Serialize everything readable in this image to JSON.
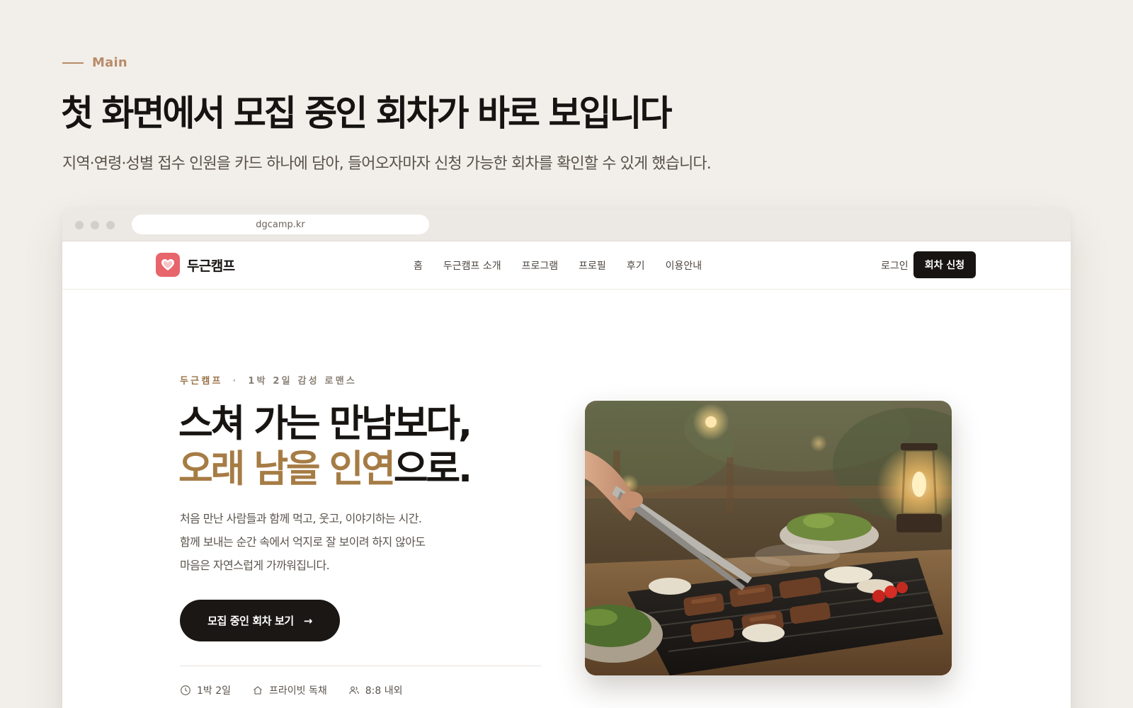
{
  "section": {
    "eyebrow": "Main",
    "title": "첫 화면에서 모집 중인 회차가 바로 보입니다",
    "description": "지역·연령·성별 접수 인원을 카드 하나에 담아, 들어오자마자 신청 가능한 회차를 확인할 수 있게 했습니다."
  },
  "browser": {
    "url": "dgcamp.kr"
  },
  "site": {
    "logo_text": "두근캠프",
    "nav": [
      "홈",
      "두근캠프 소개",
      "프로그램",
      "프로필",
      "후기",
      "이용안내"
    ],
    "login_label": "로그인",
    "apply_label": "회차 신청"
  },
  "hero": {
    "eyebrow_brand": "두근캠프",
    "eyebrow_sep": "·",
    "eyebrow_tagline": "1박 2일 감성 로맨스",
    "title_line1": "스쳐 가는 만남보다,",
    "title_line2_accent": "오래 남을 인연",
    "title_line2_rest": "으로.",
    "copy": [
      "처음 만난 사람들과 함께 먹고, 웃고, 이야기하는 시간.",
      "함께 보내는 순간 속에서 억지로 잘 보이려 하지 않아도",
      "마음은 자연스럽게 가까워집니다."
    ],
    "cta_label": "모집 중인 회차 보기",
    "cta_arrow": "→",
    "meta": {
      "duration": "1박 2일",
      "lodging": "프라이빗 독채",
      "ratio": "8:8 내외"
    },
    "photo_icon": "bbq-grill-photo"
  },
  "colors": {
    "page_bg": "#f2efea",
    "accent_gold": "#a67c45",
    "eyebrow_tan": "#b98c6a",
    "logo_red": "#e7656b",
    "button_dark": "#171412"
  }
}
